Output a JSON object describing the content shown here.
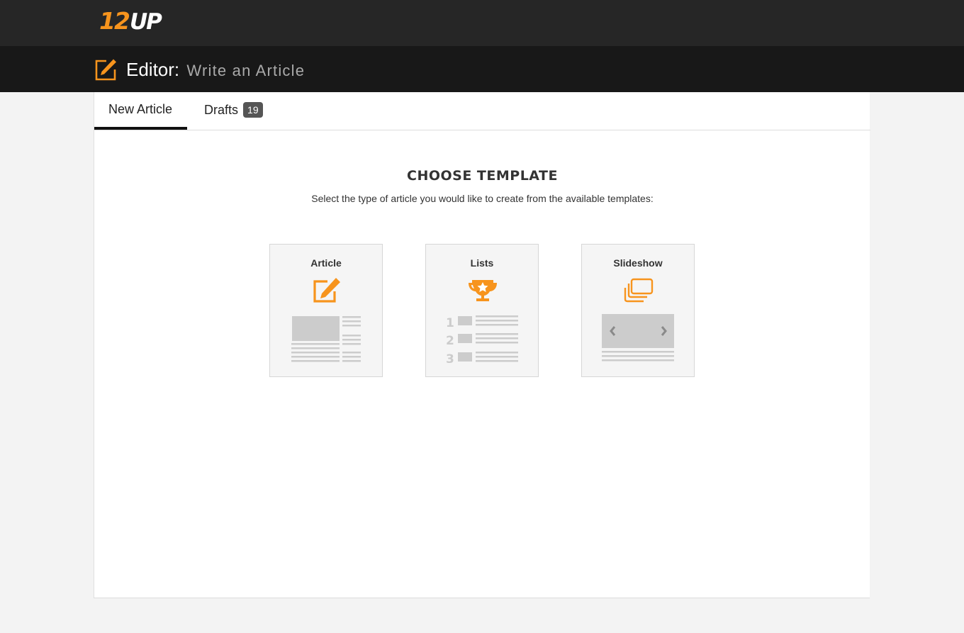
{
  "brand": {
    "logo_num": "12",
    "logo_up": "UP"
  },
  "editor": {
    "title": "Editor:",
    "subtitle": "Write an Article"
  },
  "tabs": [
    {
      "label": "New Article"
    },
    {
      "label": "Drafts",
      "count": "19"
    }
  ],
  "main": {
    "heading": "CHOOSE TEMPLATE",
    "description": "Select the type of article you would like to create from the available templates:"
  },
  "templates": [
    {
      "title": "Article",
      "icon": "edit-icon"
    },
    {
      "title": "Lists",
      "icon": "trophy-icon",
      "numbers": [
        "1",
        "2",
        "3"
      ]
    },
    {
      "title": "Slideshow",
      "icon": "images-icon"
    }
  ],
  "colors": {
    "accent": "#f7941d",
    "topbar": "#262626",
    "editorbar": "#181818"
  }
}
